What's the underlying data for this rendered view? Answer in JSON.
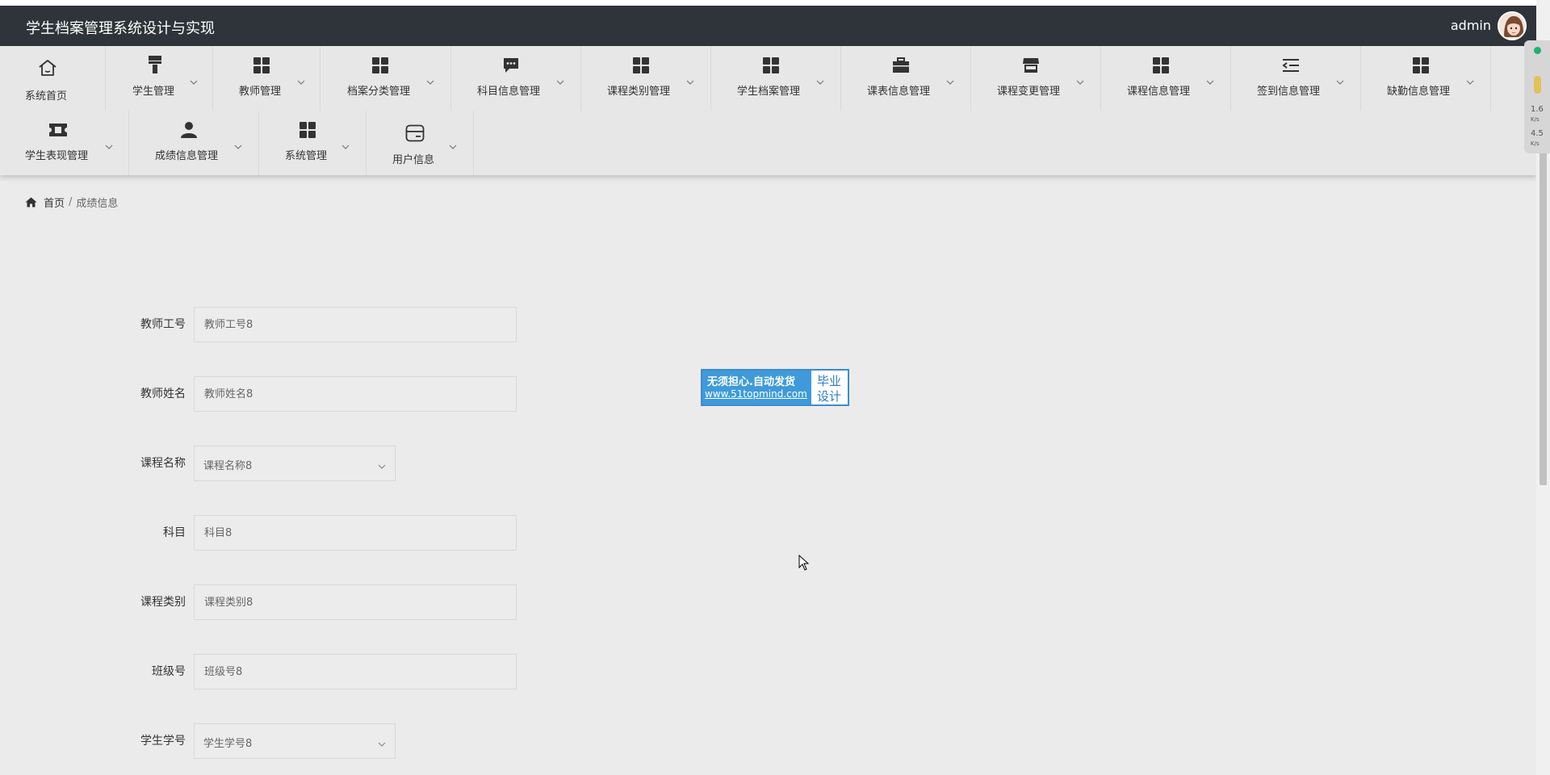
{
  "header": {
    "title": "学生档案管理系统设计与实现",
    "user": "admin"
  },
  "nav": {
    "row1": [
      {
        "label": "系统首页",
        "icon": "home-icon"
      },
      {
        "label": "学生管理",
        "icon": "brush-icon"
      },
      {
        "label": "教师管理",
        "icon": "grid-icon"
      },
      {
        "label": "档案分类管理",
        "icon": "grid-icon"
      },
      {
        "label": "科目信息管理",
        "icon": "message-icon"
      },
      {
        "label": "课程类别管理",
        "icon": "grid-icon"
      },
      {
        "label": "学生档案管理",
        "icon": "grid-icon"
      },
      {
        "label": "课表信息管理",
        "icon": "briefcase-icon"
      },
      {
        "label": "课程变更管理",
        "icon": "store-icon"
      },
      {
        "label": "课程信息管理",
        "icon": "grid-icon"
      },
      {
        "label": "签到信息管理",
        "icon": "list-indent-icon"
      },
      {
        "label": "缺勤信息管理",
        "icon": "grid-icon"
      }
    ],
    "row2": [
      {
        "label": "学生表现管理",
        "icon": "ticket-icon"
      },
      {
        "label": "成绩信息管理",
        "icon": "user-icon"
      },
      {
        "label": "系统管理",
        "icon": "grid-icon"
      },
      {
        "label": "用户信息",
        "icon": "card-icon"
      }
    ]
  },
  "breadcrumb": {
    "home": "首页",
    "separator": "/",
    "current": "成绩信息"
  },
  "form": {
    "teacher_id": {
      "label": "教师工号",
      "placeholder": "教师工号8"
    },
    "teacher_name": {
      "label": "教师姓名",
      "placeholder": "教师姓名8"
    },
    "course_name": {
      "label": "课程名称",
      "value": "课程名称8"
    },
    "subject": {
      "label": "科目",
      "placeholder": "科目8"
    },
    "course_category": {
      "label": "课程类别",
      "placeholder": "课程类别8"
    },
    "class_no": {
      "label": "班级号",
      "placeholder": "班级号8"
    },
    "student_id": {
      "label": "学生学号",
      "value": "学生学号8"
    }
  },
  "ad": {
    "line1": "无须担心.自动发货",
    "line2": "www.51topmind.com",
    "right1": "毕业",
    "right2": "设计"
  },
  "monitor": {
    "up": "1.6",
    "down": "4.5",
    "unit": "K/s"
  }
}
